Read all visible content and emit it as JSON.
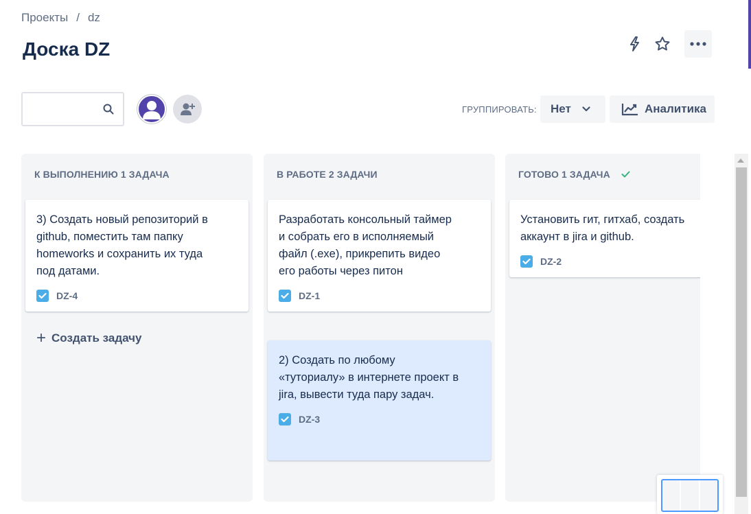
{
  "breadcrumb": {
    "projects": "Проекты",
    "separator": "/",
    "project": "dz"
  },
  "page_title": "Доска DZ",
  "header_icons": [
    "lightning-icon",
    "star-icon",
    "more-icon"
  ],
  "toolbar": {
    "search_placeholder": "",
    "group_label": "ГРУППИРОВАТЬ:",
    "group_value": "Нет",
    "analytics_label": "Аналитика"
  },
  "columns": [
    {
      "title": "К ВЫПОЛНЕНИЮ 1 ЗАДАЧА",
      "cards": [
        {
          "text": "3) Создать новый репозиторий в github, поместить там папку homeworks и сохранить их туда под датами.",
          "key": "DZ-4"
        }
      ],
      "create_label": "Создать задачу"
    },
    {
      "title": "В РАБОТЕ 2 ЗАДАЧИ",
      "cards": [
        {
          "text": "Разработать консольный таймер и собрать его в исполняемый файл (.exe), прикрепить видео его работы через питон",
          "key": "DZ-1"
        },
        {
          "text": "2) Создать по любому «туториалу» в интернете проект в jira, вывести туда пару задач.",
          "key": "DZ-3"
        }
      ]
    },
    {
      "title": "ГОТОВО 1 ЗАДАЧА",
      "cards": [
        {
          "text": "Установить гит, гитхаб, создать аккаунт в jira и github.",
          "key": "DZ-2"
        }
      ]
    }
  ],
  "colors": {
    "accent": "#0052cc",
    "task_icon": "#4bade8",
    "done_check": "#36b37e",
    "selected_card": "#deebff"
  }
}
